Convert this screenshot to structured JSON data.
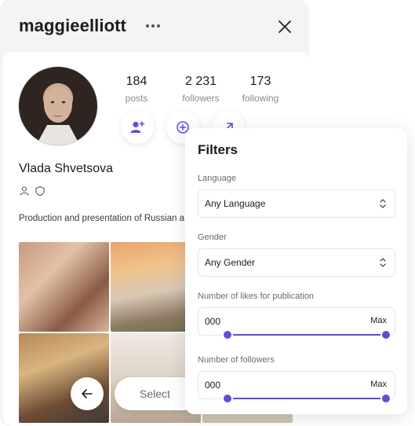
{
  "profile": {
    "username": "maggieelliott",
    "full_name": "Vlada Shvetsova",
    "bio": "Production and presentation of Russian a",
    "stats": [
      {
        "value": "184",
        "label": "posts"
      },
      {
        "value": "2 231",
        "label": "followers"
      },
      {
        "value": "173",
        "label": "following"
      }
    ],
    "actions": {
      "follow_icon": "user-plus-icon",
      "add_icon": "plus-circle-icon",
      "share_icon": "external-link-icon"
    },
    "badges": [
      "user-icon",
      "shield-icon"
    ],
    "grid_tiles": 6,
    "select_label": "Select",
    "accent_color": "#5b4fdb"
  },
  "filters": {
    "title": "Filters",
    "language": {
      "label": "Language",
      "selected": "Any Language"
    },
    "gender": {
      "label": "Gender",
      "selected": "Any Gender"
    },
    "likes": {
      "label": "Number of likes for publication",
      "min": "000",
      "max": "Max",
      "range_fraction": [
        0.0,
        1.0
      ]
    },
    "followers": {
      "label": "Number of followers",
      "min": "000",
      "max": "Max",
      "range_fraction": [
        0.0,
        1.0
      ]
    }
  }
}
